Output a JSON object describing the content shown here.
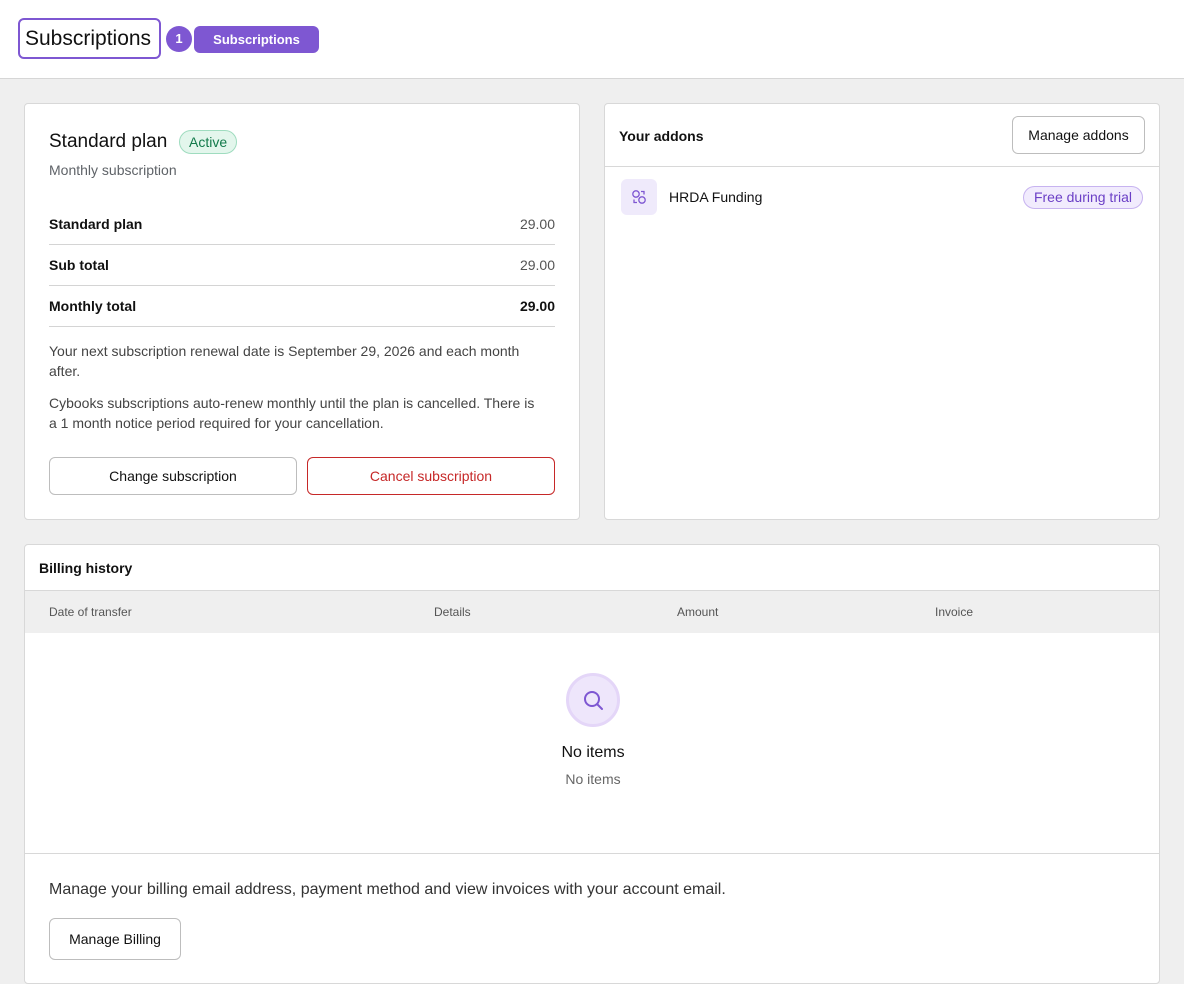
{
  "header": {
    "title": "Subscriptions",
    "count": "1",
    "tag": "Subscriptions",
    "accent": "#7e57d2"
  },
  "plan": {
    "name": "Standard plan",
    "status": "Active",
    "frequency": "Monthly subscription",
    "lines": [
      {
        "label": "Standard plan",
        "value": "29.00"
      },
      {
        "label": "Sub total",
        "value": "29.00"
      },
      {
        "label": "Monthly total",
        "value": "29.00"
      }
    ],
    "renewal_note": "Your next subscription renewal date is September 29, 2026 and each month after.",
    "cancel_note": "Cybooks subscriptions auto-renew monthly until the plan is cancelled. There is a 1 month notice period required for your cancellation.",
    "change_label": "Change subscription",
    "cancel_label": "Cancel subscription"
  },
  "addons": {
    "title": "Your addons",
    "manage_label": "Manage addons",
    "items": [
      {
        "name": "HRDA Funding",
        "badge": "Free during trial",
        "icon": "funding-icon"
      }
    ]
  },
  "billing": {
    "title": "Billing history",
    "columns": [
      "Date of transfer",
      "Details",
      "Amount",
      "Invoice"
    ],
    "empty_title": "No items",
    "empty_sub": "No items",
    "note": "Manage your billing email address, payment method and view invoices with your account email.",
    "manage_label": "Manage Billing"
  }
}
